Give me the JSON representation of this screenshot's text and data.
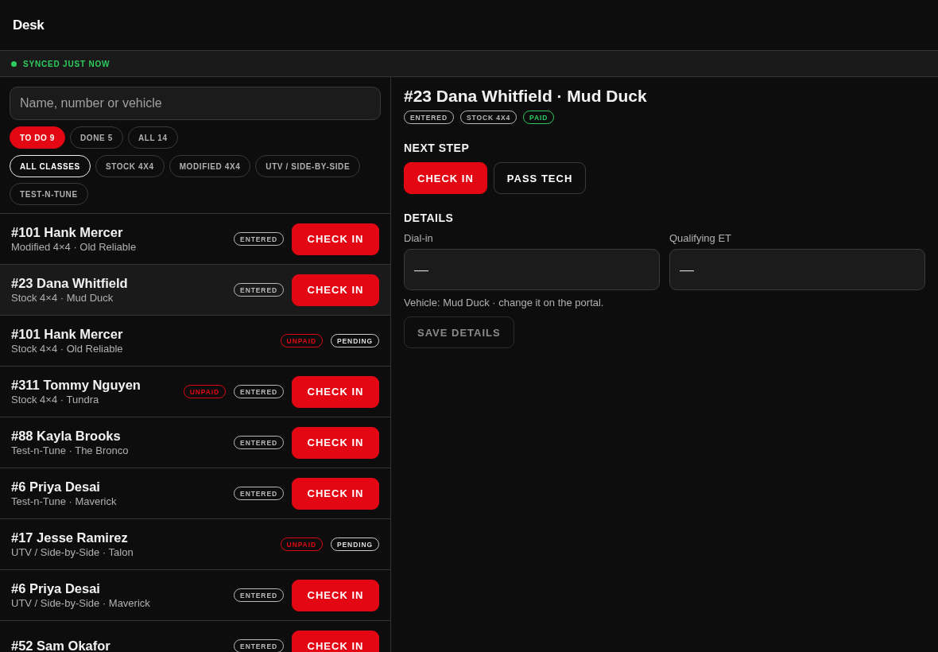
{
  "header": {
    "title": "Desk"
  },
  "sync": {
    "label": "SYNCED JUST NOW",
    "color": "#2ecc5e"
  },
  "search": {
    "placeholder": "Name, number or vehicle"
  },
  "status_filters": [
    {
      "label": "TO DO 9",
      "selected": true
    },
    {
      "label": "DONE 5",
      "selected": false
    },
    {
      "label": "ALL 14",
      "selected": false
    }
  ],
  "class_filters": [
    {
      "label": "ALL CLASSES",
      "selected": true
    },
    {
      "label": "STOCK 4X4",
      "selected": false
    },
    {
      "label": "MODIFIED 4X4",
      "selected": false
    },
    {
      "label": "UTV / SIDE-BY-SIDE",
      "selected": false
    },
    {
      "label": "TEST-N-TUNE",
      "selected": false
    }
  ],
  "entries": [
    {
      "name": "#101 Hank Mercer",
      "subtitle": "Modified 4×4 · Old Reliable",
      "selected": false,
      "badges": [
        {
          "label": "ENTERED",
          "kind": "neutral"
        }
      ],
      "action": "CHECK IN"
    },
    {
      "name": "#23 Dana Whitfield",
      "subtitle": "Stock 4×4 · Mud Duck",
      "selected": true,
      "badges": [
        {
          "label": "ENTERED",
          "kind": "neutral"
        }
      ],
      "action": "CHECK IN"
    },
    {
      "name": "#101 Hank Mercer",
      "subtitle": "Stock 4×4 · Old Reliable",
      "selected": false,
      "badges": [
        {
          "label": "UNPAID",
          "kind": "alert"
        },
        {
          "label": "PENDING",
          "kind": "light"
        }
      ]
    },
    {
      "name": "#311 Tommy Nguyen",
      "subtitle": "Stock 4×4 · Tundra",
      "selected": false,
      "badges": [
        {
          "label": "UNPAID",
          "kind": "alert"
        },
        {
          "label": "ENTERED",
          "kind": "neutral"
        }
      ],
      "action": "CHECK IN"
    },
    {
      "name": "#88 Kayla Brooks",
      "subtitle": "Test-n-Tune · The Bronco",
      "selected": false,
      "badges": [
        {
          "label": "ENTERED",
          "kind": "neutral"
        }
      ],
      "action": "CHECK IN"
    },
    {
      "name": "#6 Priya Desai",
      "subtitle": "Test-n-Tune · Maverick",
      "selected": false,
      "badges": [
        {
          "label": "ENTERED",
          "kind": "neutral"
        }
      ],
      "action": "CHECK IN"
    },
    {
      "name": "#17 Jesse Ramirez",
      "subtitle": "UTV / Side-by-Side · Talon",
      "selected": false,
      "badges": [
        {
          "label": "UNPAID",
          "kind": "alert"
        },
        {
          "label": "PENDING",
          "kind": "light"
        }
      ]
    },
    {
      "name": "#6 Priya Desai",
      "subtitle": "UTV / Side-by-Side · Maverick",
      "selected": false,
      "badges": [
        {
          "label": "ENTERED",
          "kind": "neutral"
        }
      ],
      "action": "CHECK IN"
    },
    {
      "name": "#52 Sam Okafor",
      "selected": false,
      "badges": [
        {
          "label": "ENTERED",
          "kind": "neutral"
        }
      ],
      "action": "CHECK IN"
    }
  ],
  "detail": {
    "title": "#23 Dana Whitfield · Mud Duck",
    "badges": [
      {
        "label": "ENTERED",
        "kind": "neutral"
      },
      {
        "label": "STOCK 4X4",
        "kind": "neutral"
      },
      {
        "label": "PAID",
        "kind": "ok"
      }
    ],
    "next_step": "NEXT STEP",
    "actions": [
      {
        "label": "CHECK IN",
        "kind": "primary"
      },
      {
        "label": "PASS TECH",
        "kind": "secondary"
      }
    ],
    "details_heading": "DETAILS",
    "fields": [
      {
        "label": "Dial-in",
        "value": "—"
      },
      {
        "label": "Qualifying ET",
        "value": "—"
      }
    ],
    "note": "Vehicle: Mud Duck · change it on the portal.",
    "save": {
      "label": "SAVE DETAILS",
      "disabled": true
    }
  }
}
